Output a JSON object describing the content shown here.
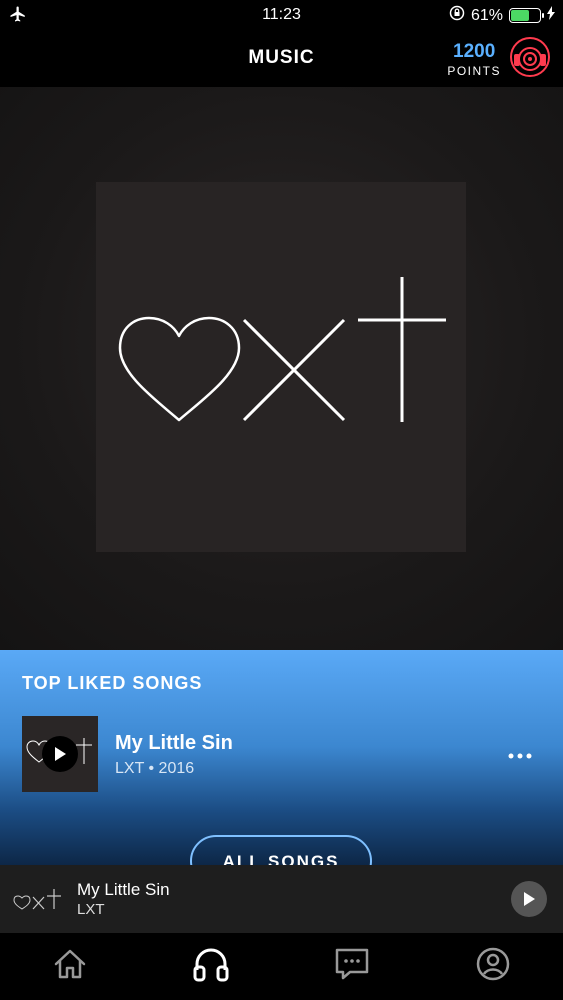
{
  "status_bar": {
    "time": "11:23",
    "battery": "61%"
  },
  "header": {
    "title": "MUSIC",
    "points_value": "1200",
    "points_label": "POINTS"
  },
  "top_liked": {
    "heading": "TOP LIKED SONGS",
    "songs": [
      {
        "title": "My Little Sin",
        "meta": "LXT • 2016"
      }
    ],
    "all_songs_label": "ALL SONGS"
  },
  "now_playing": {
    "title": "My Little Sin",
    "artist": "LXT"
  },
  "tabs": [
    "home-icon",
    "headphones-icon",
    "chat-icon",
    "profile-icon"
  ],
  "colors": {
    "accent": "#5ab0ff",
    "points_icon": "#ff3b4e",
    "battery": "#4cd964"
  }
}
